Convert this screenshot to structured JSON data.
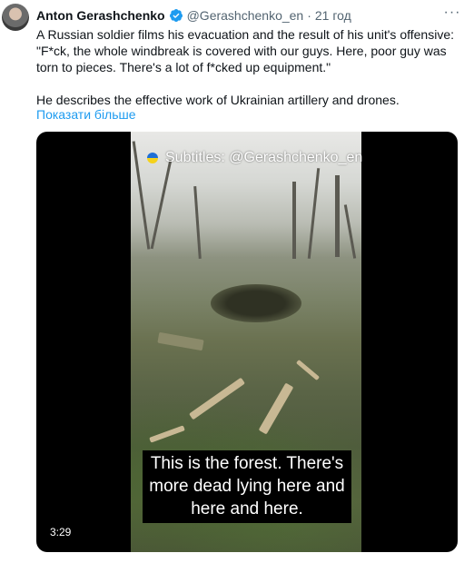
{
  "author": {
    "name": "Anton Gerashchenko",
    "handle": "@Gerashchenko_en",
    "separator": "·",
    "time": "21 год",
    "verified_icon": "verified-badge-icon",
    "verified_color": "#1d9bf0"
  },
  "tweet": {
    "text_line1": "A Russian soldier films his evacuation and the result of his unit's offensive: \"F*ck, the whole windbreak is covered with our guys. Here, poor guy was torn to pieces. There's a lot of f*cked up equipment.\"",
    "text_line2": "He describes the effective work of Ukrainian artillery and drones.",
    "show_more": "Показати більше",
    "link_color": "#1d9bf0"
  },
  "video": {
    "watermark": "Subtitles: @Gerashchenko_en",
    "caption": "This is the forest. There's more dead lying here and here and here.",
    "duration": "3:29"
  },
  "menu": {
    "more_icon": "more-dots-icon",
    "more_label": "···"
  }
}
